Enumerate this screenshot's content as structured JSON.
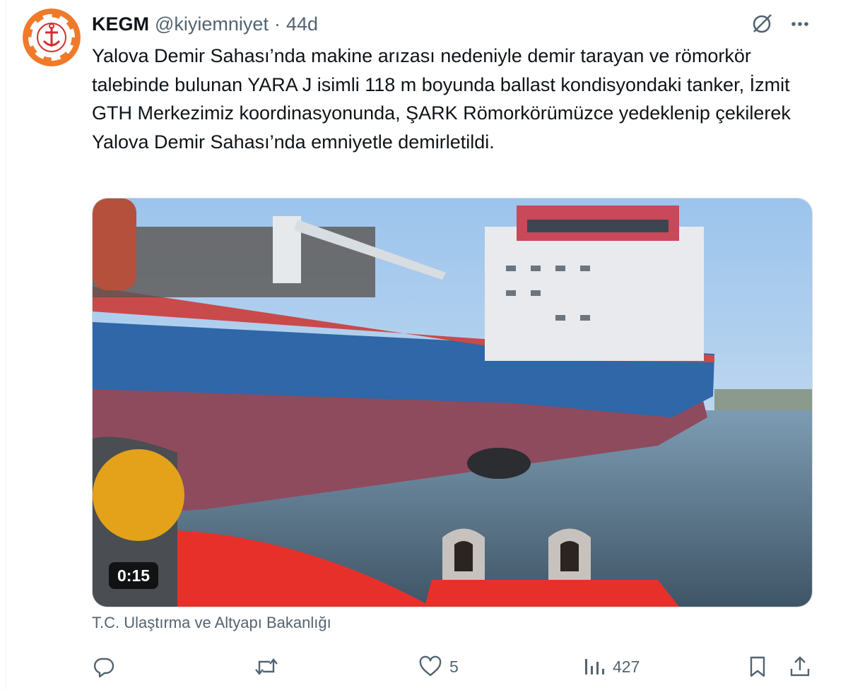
{
  "tweet": {
    "author_name": "KEGM",
    "author_handle": "@kiyiemniyet",
    "separator": "·",
    "time": "44d",
    "text": "Yalova Demir Sahası’nda makine arızası nedeniyle demir tarayan ve römorkör talebinde bulunan YARA J isimli 118 m boyunda ballast kondisyondaki tanker, İzmit GTH Merkezimiz koordinasyonunda, ŞARK Römorkörümüzce yedeklenip çekilerek Yalova Demir Sahası’nda emniyetle demirletildi.",
    "video_duration": "0:15",
    "source_label": "T.C. Ulaştırma ve Altyapı Bakanlığı"
  },
  "actions": {
    "reply": {
      "icon": "reply-icon",
      "count": ""
    },
    "repost": {
      "icon": "repost-icon",
      "count": ""
    },
    "like": {
      "icon": "heart-icon",
      "count": "5"
    },
    "views": {
      "icon": "views-icon",
      "count": "427"
    },
    "bookmark": {
      "icon": "bookmark-icon"
    },
    "share": {
      "icon": "share-icon"
    }
  },
  "icons": {
    "grok": "grok-icon",
    "more": "more-icon"
  },
  "colors": {
    "text": "#0f1419",
    "muted": "#536471",
    "avatar_orange": "#f07a2a",
    "hull_blue": "#2f67a8",
    "hull_red": "#8e4b5d",
    "tug_red": "#e8302b"
  }
}
